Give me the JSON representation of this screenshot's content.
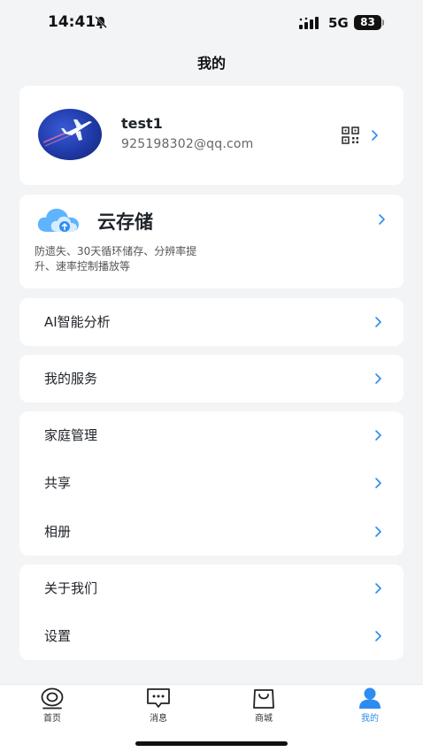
{
  "status_bar": {
    "time": "14:41",
    "network": "5G",
    "battery": "83"
  },
  "page": {
    "title": "我的"
  },
  "profile": {
    "username": "test1",
    "email": "925198302@qq.com"
  },
  "cloud": {
    "title": "云存储",
    "desc_line1": "防遗失、30天循环储存、分辨率提",
    "desc_line2": "升、速率控制播放等"
  },
  "menu": {
    "ai_analysis": "AI智能分析",
    "my_services": "我的服务",
    "family": "家庭管理",
    "share": "共享",
    "album": "相册",
    "about": "关于我们",
    "settings": "设置"
  },
  "tabs": {
    "home": "首页",
    "messages": "消息",
    "mall": "商城",
    "mine": "我的"
  },
  "colors": {
    "accent": "#2d8cf0",
    "background": "#f3f4f6",
    "card": "#ffffff"
  }
}
